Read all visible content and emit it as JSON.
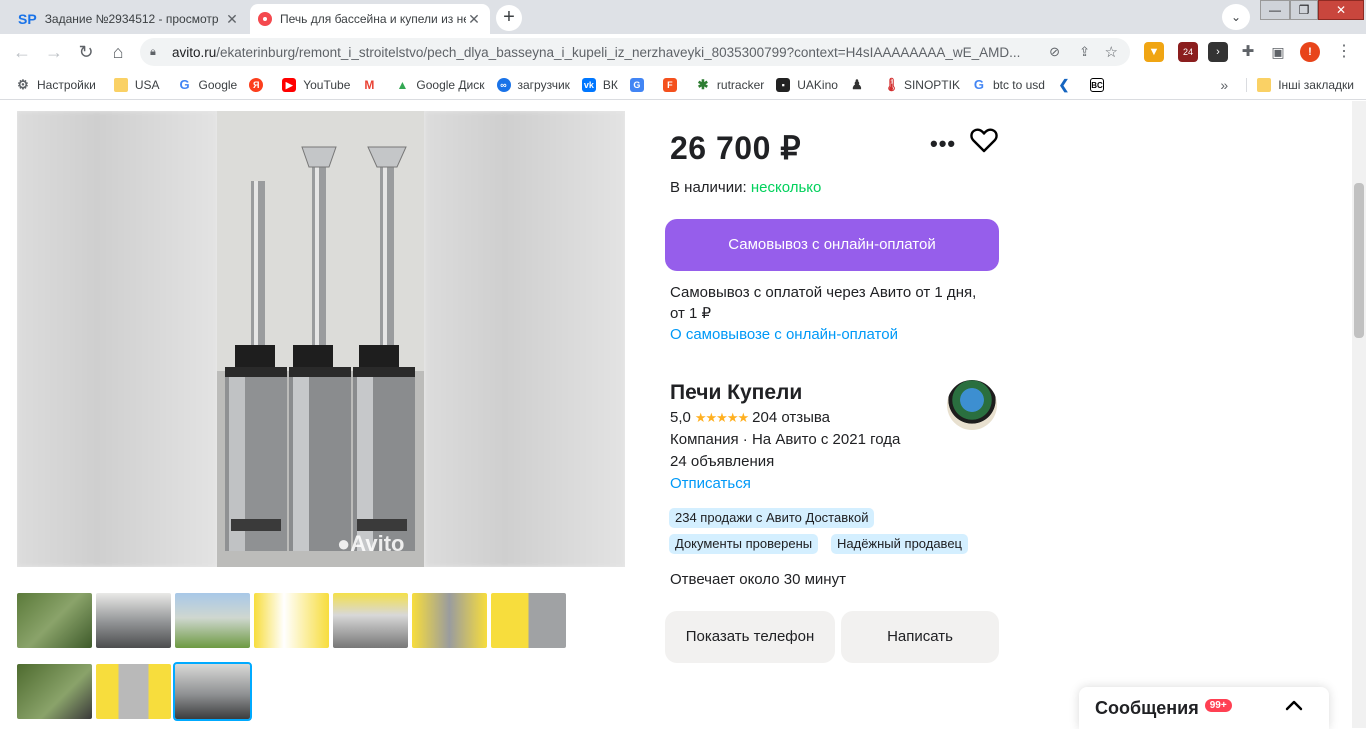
{
  "browser": {
    "tabs": [
      {
        "title": "Задание №2934512 - просмотр",
        "favicon": "SP"
      },
      {
        "title": "Печь для бассейна и купели из нержавейки",
        "favicon": "avito-icon"
      }
    ],
    "url_domain": "avito.ru",
    "url_path": "/ekaterinburg/remont_i_stroitelstvo/pech_dlya_basseyna_i_kupeli_iz_nerzhaveyki_8035300799?context=H4sIAAAAAAAA_wE_AMD...",
    "extension_badge": "24",
    "profile_initial": "!",
    "bookmarks": [
      "Настройки",
      "USA",
      "Google",
      "YouTube",
      "Google Диск",
      "загрузчик",
      "ВК",
      "rutracker",
      "UAKino",
      "SINOPTIK",
      "btc to usd"
    ],
    "other_bookmarks": "Інші закладки"
  },
  "listing": {
    "price": "26 700 ₽",
    "stock_label": "В наличии:",
    "stock_value": "несколько",
    "pickup_button": "Самовывоз с онлайн-оплатой",
    "pickup_note": "Самовывоз с оплатой через Авито от 1 дня, от 1 ₽",
    "pickup_link": "О самовывозе с онлайн-оплатой",
    "watermark": "Avito"
  },
  "seller": {
    "name": "Печи Купели",
    "rating": "5,0",
    "stars": "★★★★★",
    "reviews": "204 отзыва",
    "company": "Компания · На Авито с 2021 года",
    "ads_count": "24 объявления",
    "unsubscribe": "Отписаться",
    "badges": [
      "234 продажи с Авито Доставкой",
      "Документы проверены",
      "Надёжный продавец"
    ],
    "response_time": "Отвечает около 30 минут"
  },
  "actions": {
    "show_phone": "Показать телефон",
    "write": "Написать"
  },
  "messages": {
    "title": "Сообщения",
    "count": "99+"
  },
  "colors": {
    "accent_purple": "#965eeb",
    "link_blue": "#0099f7",
    "in_stock_green": "#02d15c",
    "badge_bg": "#d4efff"
  }
}
